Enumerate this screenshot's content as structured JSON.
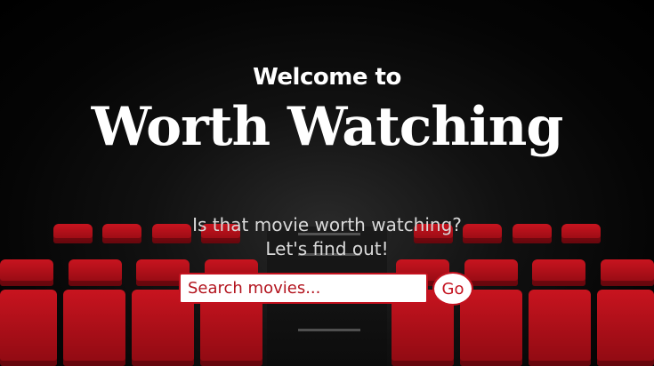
{
  "hero": {
    "welcome": "Welcome to",
    "title": "Worth Watching",
    "tagline_line1": "Is that movie worth watching?",
    "tagline_line2": "Let's find out!"
  },
  "search": {
    "placeholder": "Search movies...",
    "value": "",
    "button_label": "Go"
  },
  "colors": {
    "accent": "#c4121f",
    "seat_red": "#c8141f",
    "background": "#000000"
  }
}
